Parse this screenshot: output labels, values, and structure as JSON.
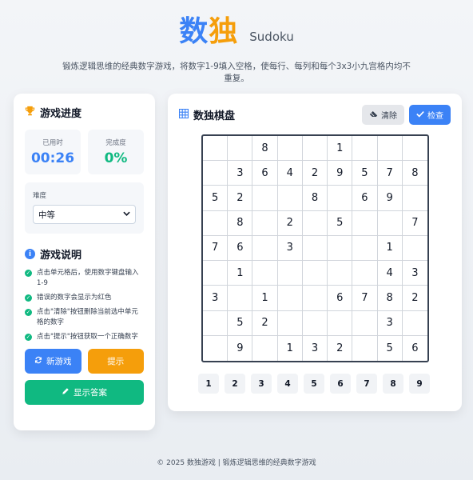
{
  "header": {
    "title_part1": "数",
    "title_part2": "独",
    "title_en": "Sudoku",
    "subtitle": "锻炼逻辑思维的经典数字游戏，将数字1-9填入空格，使每行、每列和每个3x3小九宫格内均不重复。"
  },
  "progress": {
    "title": "游戏进度",
    "time_label": "已用时",
    "time_value": "00:26",
    "completion_label": "完成度",
    "completion_value": "0%"
  },
  "difficulty": {
    "label": "难度",
    "selected": "中等"
  },
  "instructions": {
    "title": "游戏说明",
    "items": [
      "点击单元格后，使用数字键盘输入1-9",
      "错误的数字会显示为红色",
      "点击\"清除\"按钮删除当前选中单元格的数字",
      "点击\"提示\"按钮获取一个正确数字"
    ]
  },
  "buttons": {
    "new_game": "新游戏",
    "hint": "提示",
    "show_answer": "显示答案"
  },
  "board_panel": {
    "title": "数独棋盘",
    "clear": "清除",
    "check": "检查"
  },
  "board": [
    [
      "",
      "",
      "8",
      "",
      "",
      "1",
      "",
      "",
      ""
    ],
    [
      "",
      "3",
      "6",
      "4",
      "2",
      "9",
      "5",
      "7",
      "8"
    ],
    [
      "5",
      "2",
      "",
      "",
      "8",
      "",
      "6",
      "9",
      ""
    ],
    [
      "",
      "8",
      "",
      "2",
      "",
      "5",
      "",
      "",
      "7"
    ],
    [
      "7",
      "6",
      "",
      "3",
      "",
      "",
      "",
      "1",
      ""
    ],
    [
      "",
      "1",
      "",
      "",
      "",
      "",
      "",
      "4",
      "3"
    ],
    [
      "3",
      "",
      "1",
      "",
      "",
      "6",
      "7",
      "8",
      "2"
    ],
    [
      "",
      "5",
      "2",
      "",
      "",
      "",
      "",
      "3",
      ""
    ],
    [
      "",
      "9",
      "",
      "1",
      "3",
      "2",
      "",
      "5",
      "6"
    ]
  ],
  "numpad": [
    "1",
    "2",
    "3",
    "4",
    "5",
    "6",
    "7",
    "8",
    "9"
  ],
  "footer": "© 2025 数独游戏 | 锻炼逻辑思维的经典数字游戏",
  "colors": {
    "primary_blue": "#3b82f6",
    "orange": "#f59e0b",
    "green": "#10b981"
  }
}
